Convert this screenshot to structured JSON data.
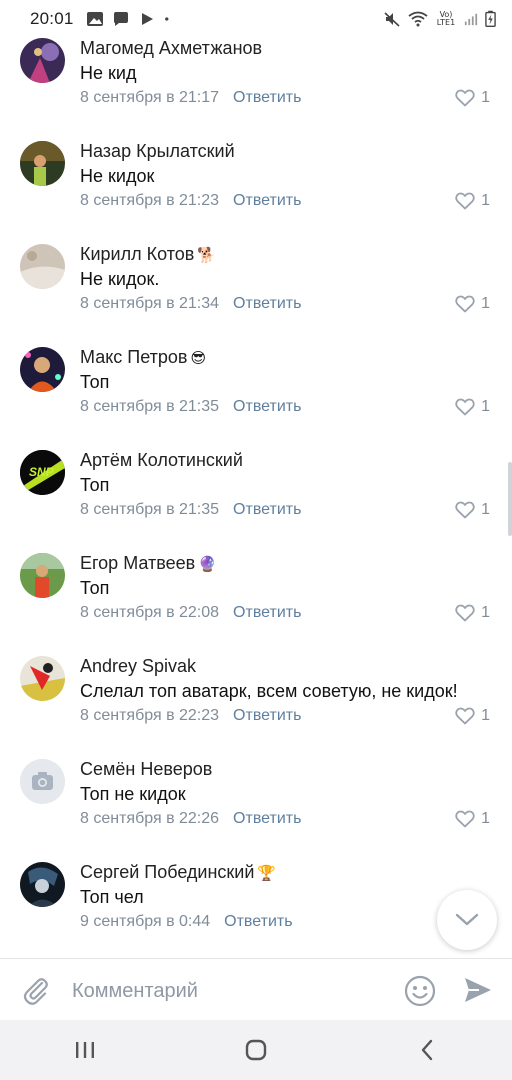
{
  "status_bar": {
    "time": "20:01",
    "network_label": "Vo) LTE1"
  },
  "comments": [
    {
      "name": "Магомед Ахметжанов",
      "name_emoji": "",
      "text": "Не кид",
      "date": "8 сентября в 21:17",
      "reply_label": "Ответить",
      "likes": "1",
      "avatar_icon": "avatar-photo"
    },
    {
      "name": "Назар Крылатский",
      "name_emoji": "",
      "text": "Не кидок",
      "date": "8 сентября в 21:23",
      "reply_label": "Ответить",
      "likes": "1",
      "avatar_icon": "avatar-photo"
    },
    {
      "name": "Кирилл Котов",
      "name_emoji": "🐕",
      "text": "Не кидок.",
      "date": "8 сентября в 21:34",
      "reply_label": "Ответить",
      "likes": "1",
      "avatar_icon": "avatar-photo"
    },
    {
      "name": "Макс Петров",
      "name_emoji": "😎",
      "text": "Топ",
      "date": "8 сентября в 21:35",
      "reply_label": "Ответить",
      "likes": "1",
      "avatar_icon": "avatar-photo"
    },
    {
      "name": "Артём Колотинский",
      "name_emoji": "",
      "text": "Топ",
      "date": "8 сентября в 21:35",
      "reply_label": "Ответить",
      "likes": "1",
      "avatar_icon": "avatar-logo",
      "avatar_text": "SNP"
    },
    {
      "name": "Егор Матвеев",
      "name_emoji": "🔮",
      "text": "Топ",
      "date": "8 сентября в 22:08",
      "reply_label": "Ответить",
      "likes": "1",
      "avatar_icon": "avatar-photo"
    },
    {
      "name": "Andrey Spivak",
      "name_emoji": "",
      "text": "Слелал топ аватарк, всем советую, не кидок!",
      "date": "8 сентября в 22:23",
      "reply_label": "Ответить",
      "likes": "1",
      "avatar_icon": "avatar-photo"
    },
    {
      "name": "Семён Неверов",
      "name_emoji": "",
      "text": "Топ не кидок",
      "date": "8 сентября в 22:26",
      "reply_label": "Ответить",
      "likes": "1",
      "avatar_icon": "camera-placeholder-icon"
    },
    {
      "name": "Сергей Побединский",
      "name_emoji": "🏆",
      "text": "Топ чел",
      "date": "9 сентября в 0:44",
      "reply_label": "Ответить",
      "likes": "",
      "avatar_icon": "avatar-photo"
    }
  ],
  "composer": {
    "placeholder": "Комментарий"
  },
  "colors": {
    "link": "#5f7f9e",
    "meta": "#818c99",
    "icon": "#99a2ad"
  }
}
